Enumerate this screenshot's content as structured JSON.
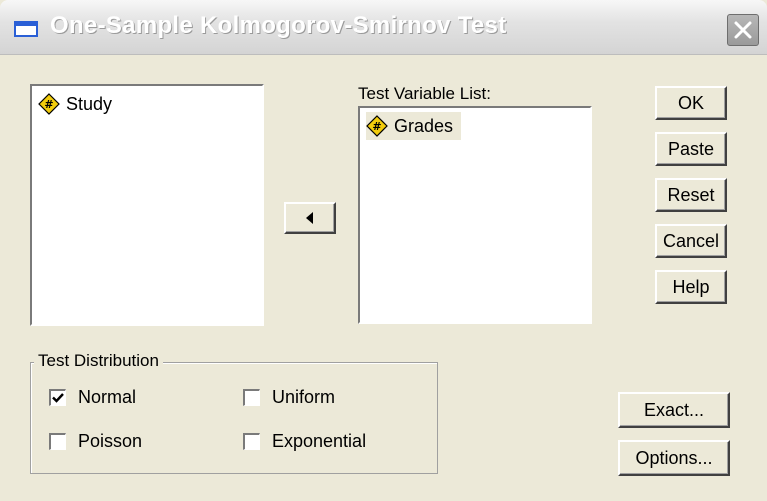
{
  "window": {
    "title": "One-Sample Kolmogorov-Smirnov Test"
  },
  "source_list": {
    "items": [
      {
        "label": "Study",
        "icon": "numeric-variable-icon"
      }
    ]
  },
  "test_variable_list": {
    "label": "Test Variable List:",
    "items": [
      {
        "label": "Grades",
        "icon": "numeric-variable-icon"
      }
    ]
  },
  "buttons": {
    "ok": "OK",
    "paste": "Paste",
    "reset": "Reset",
    "cancel": "Cancel",
    "help": "Help",
    "exact": "Exact...",
    "options": "Options..."
  },
  "test_distribution": {
    "legend": "Test Distribution",
    "options": [
      {
        "label": "Normal",
        "checked": true
      },
      {
        "label": "Uniform",
        "checked": false
      },
      {
        "label": "Poisson",
        "checked": false
      },
      {
        "label": "Exponential",
        "checked": false
      }
    ]
  },
  "colors": {
    "accent_icon": "#f2cc0c",
    "title_text": "#ffffff",
    "dialog_bg": "#ece9d8"
  }
}
